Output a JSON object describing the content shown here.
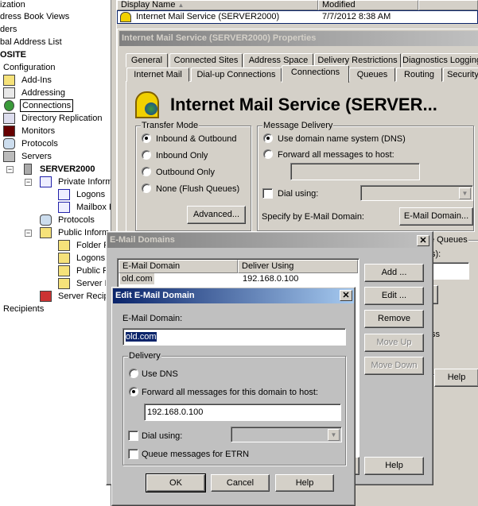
{
  "tree": {
    "items": [
      {
        "label": "ization"
      },
      {
        "label": "dress Book Views"
      },
      {
        "label": "ders"
      },
      {
        "label": "bal Address List"
      },
      {
        "label": "OSITE"
      },
      {
        "label": "Configuration"
      },
      {
        "label": "Add-Ins"
      },
      {
        "label": "Addressing"
      },
      {
        "label": "Connections"
      },
      {
        "label": "Directory Replication"
      },
      {
        "label": "Monitors"
      },
      {
        "label": "Protocols"
      },
      {
        "label": "Servers"
      },
      {
        "label": "SERVER2000"
      },
      {
        "label": "Private Inform"
      },
      {
        "label": "Logons"
      },
      {
        "label": "Mailbox F"
      },
      {
        "label": "Protocols"
      },
      {
        "label": "Public Inform"
      },
      {
        "label": "Folder F"
      },
      {
        "label": "Logons"
      },
      {
        "label": "Public F"
      },
      {
        "label": "Server I"
      },
      {
        "label": "Server Recip"
      },
      {
        "label": "Recipients"
      }
    ]
  },
  "list": {
    "columns": [
      "Display Name",
      "Modified"
    ],
    "sort_indicator": "▲",
    "rows": [
      {
        "name": "Internet Mail Service (SERVER2000)",
        "modified": "7/7/2012  8:38 AM"
      }
    ]
  },
  "properties": {
    "title": "Internet Mail Service (SERVER2000) Properties",
    "tabs_row1": [
      "General",
      "Connected Sites",
      "Address Space",
      "Delivery Restrictions",
      "Diagnostics Logging"
    ],
    "tabs_row2": [
      "Internet Mail",
      "Dial-up Connections",
      "Connections",
      "Queues",
      "Routing",
      "Security"
    ],
    "active_tab": "Connections",
    "heading": "Internet Mail Service (SERVER...",
    "transfer_mode": {
      "label": "Transfer Mode",
      "options": [
        "Inbound & Outbound",
        "Inbound Only",
        "Outbound Only",
        "None (Flush Queues)"
      ],
      "selected": "Inbound & Outbound",
      "advanced": "Advanced..."
    },
    "message_delivery": {
      "label": "Message Delivery",
      "options": [
        "Use domain name system (DNS)",
        "Forward all messages to host:"
      ],
      "selected": "Use domain name system (DNS)",
      "host": "",
      "dial_using": "Dial using:",
      "specify": "Specify by E-Mail Domain:",
      "email_domain_button": "E-Mail Domain..."
    },
    "queues_partial": {
      "label": "e Queues",
      "sub": "s):",
      "text": "ss"
    },
    "help": "Help"
  },
  "email_domains": {
    "title": "E-Mail Domains",
    "columns": [
      "E-Mail Domain",
      "Deliver Using"
    ],
    "rows": [
      {
        "domain": "old.com",
        "deliver": "192.168.0.100"
      }
    ],
    "buttons": {
      "add": "Add ...",
      "edit": "Edit ...",
      "remove": "Remove",
      "move_up": "Move Up",
      "move_down": "Move Down",
      "help": "Help"
    }
  },
  "edit_domain": {
    "title": "Edit E-Mail Domain",
    "domain_label": "E-Mail Domain:",
    "domain_value": "old.com",
    "delivery_label": "Delivery",
    "use_dns": "Use DNS",
    "forward": "Forward all messages for this domain to host:",
    "selected": "forward",
    "host": "192.168.0.100",
    "dial_using": "Dial using:",
    "queue_etrn": "Queue messages for ETRN",
    "queue_checked": false,
    "dial_checked": false,
    "ok": "OK",
    "cancel": "Cancel",
    "help": "Help"
  }
}
